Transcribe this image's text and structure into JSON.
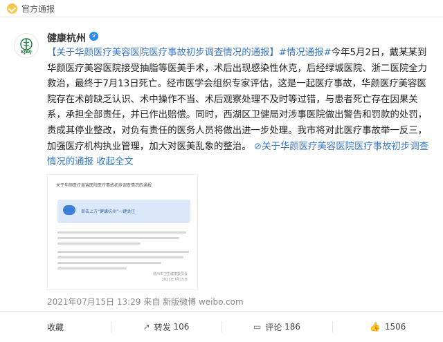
{
  "badge": {
    "icon": "verified-check-icon",
    "text": "官方通报"
  },
  "account": {
    "avatar_icon": "health-caduceus-logo",
    "avatar_label": "KJWJ",
    "name": "健康杭州",
    "verified_icon": "verified-v-icon",
    "verified_symbol": "v"
  },
  "post": {
    "headline": "【关于华颜医疗美容医院医疗事故初步调查情况的通报】",
    "tag": "#情况通报#",
    "body": "今年5月2日，戴某某到华颜医疗美容医院接受抽脂等医美手术，术后出现感染性休克，后经绿城医院、浙二医院全力救治，最终于7月13日死亡。经市医学会组织专家评估，这是一起医疗事故，华颜医疗美容医院存在术前缺乏认识、术中操作不当、术后观察处理不及时等过错，与患者死亡存在因果关系，承担全部责任，并已作出赔偿。同时，西湖区卫健局对涉事医院做出警告和罚款的处罚，责成其停业整改，对负有责任的医务人员将做出进一步处理。我市将对此医疗事故举一反三，加强医疗机构执业管理，加大对医美乱象的整治。",
    "link_icon": "link-icon",
    "link_text": "关于华颜医疗美容医院医疗事故初步调查情况的通报",
    "collapse_text": "收起全文"
  },
  "attachment": {
    "title": "关于华颜医疗美容医院医疗事故初步调查情况的通报",
    "banner_text": "单击上方“健康杭州”一键关注",
    "footer": "杭州市卫生健康委员会\n2021年7月15日"
  },
  "meta": {
    "timestamp": "2021年07月15日 13:29",
    "source": "来自 新版微博 weibo.com"
  },
  "actions": {
    "favorite": "收藏",
    "share_label": "转发",
    "share_count": "106",
    "comment_label": "评论",
    "comment_count": "186",
    "like_count": "1506"
  }
}
